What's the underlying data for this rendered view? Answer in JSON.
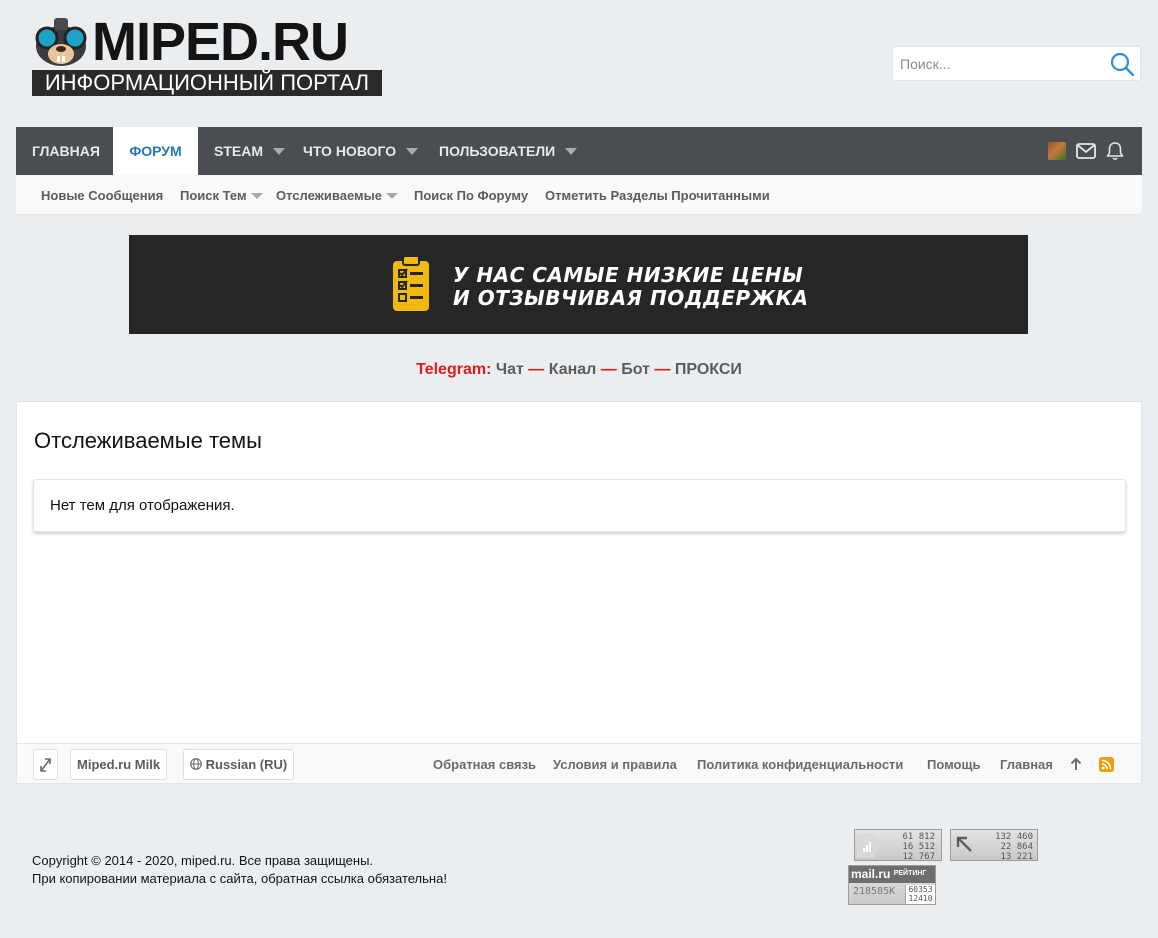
{
  "logo": {
    "title": "MIPED.RU",
    "subtitle": "ИНФОРМАЦИОННЫЙ ПОРТАЛ"
  },
  "search": {
    "placeholder": "Поиск..."
  },
  "nav": {
    "tabs": [
      {
        "label": "ГЛАВНАЯ"
      },
      {
        "label": "ФОРУМ"
      },
      {
        "label": "STEAM"
      },
      {
        "label": "ЧТО НОВОГО"
      },
      {
        "label": "ПОЛЬЗОВАТЕЛИ"
      }
    ],
    "icons": [
      "avatar",
      "envelope-icon",
      "bell-icon"
    ]
  },
  "subnav": {
    "items": [
      {
        "label": "Новые Сообщения"
      },
      {
        "label": "Поиск Тем"
      },
      {
        "label": "Отслеживаемые"
      },
      {
        "label": "Поиск По Форуму"
      },
      {
        "label": "Отметить Разделы Прочитанными"
      }
    ]
  },
  "banner": {
    "line1": "У НАС САМЫЕ НИЗКИЕ ЦЕНЫ",
    "line2": "И ОТЗЫВЧИВАЯ ПОДДЕРЖКА",
    "accent": "#f2b90f"
  },
  "telegram": {
    "label": "Telegram:",
    "links": [
      "Чат",
      "Канал",
      "Бот",
      "ПРОКСИ"
    ],
    "dash": "—"
  },
  "main": {
    "title": "Отслеживаемые темы",
    "empty_notice": "Нет тем для отображения."
  },
  "footer": {
    "style_chooser": "Miped.ru Milk",
    "language": "Russian (RU)",
    "links": [
      "Обратная связь",
      "Условия и правила",
      "Политика конфиденциальности",
      "Помощь",
      "Главная"
    ]
  },
  "copyright": {
    "line1": "Copyright © 2014 - 2020, miped.ru. Все права защищены.",
    "line2": "При копировании материала с сайта, обратная ссылка обязательна!"
  },
  "counters": {
    "liveinternet": [
      "61 812",
      "16 512",
      "12 767"
    ],
    "second": [
      "132 460",
      "22 864",
      "13 221"
    ],
    "mailru": {
      "brand": "mail.ru",
      "tag": "РЕЙТИНГ",
      "total": "218585K",
      "v1": "60353",
      "v2": "12410"
    }
  },
  "colors": {
    "nav_bg": "#4a4d52",
    "active_tab_text": "#2577b1",
    "page_bg": "#ebeef1",
    "telegram_red": "#e41a1a"
  }
}
